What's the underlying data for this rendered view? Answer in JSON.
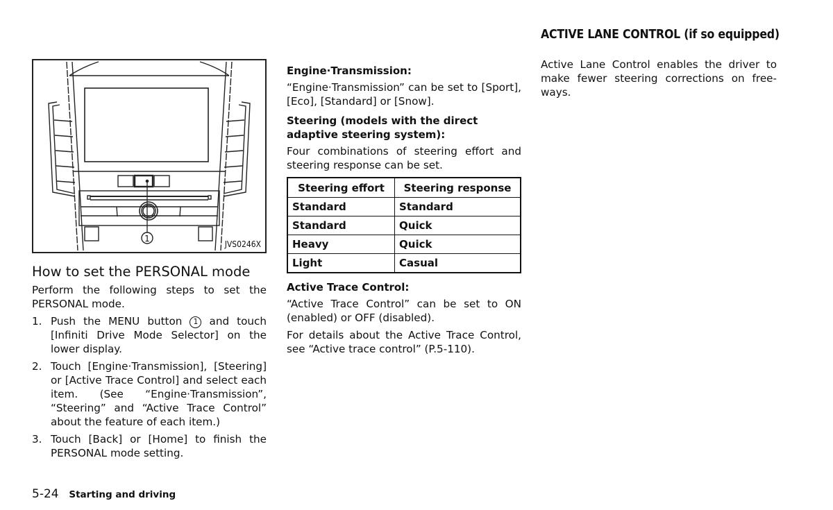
{
  "figure": {
    "code": "JVS0246X",
    "callout": "1",
    "callout_target": "menu-button"
  },
  "left_column": {
    "heading": "How to set the PERSONAL mode",
    "intro": "Perform the following steps to set the PERSONAL mode.",
    "steps": [
      {
        "num": "1.",
        "before": "Push the MENU button",
        "callout": "1",
        "after": "and touch [Infiniti Drive Mode Selector] on the lower display."
      },
      {
        "num": "2.",
        "text": "Touch [Engine·Transmission], [Steering] or [Active Trace Control] and select each item. (See “Engine·Transmission”, “Steering” and “Active Trace Control” about the feature of each item.)"
      },
      {
        "num": "3.",
        "text": "Touch [Back] or [Home] to finish the PERSONAL mode setting."
      }
    ]
  },
  "middle_column": {
    "engine_heading": "Engine·Transmission:",
    "engine_text": "“Engine·Transmission” can be set to [Sport], [Eco], [Standard] or [Snow].",
    "steering_heading": "Steering (models with the direct adaptive steering system):",
    "steering_text": "Four combinations of steering effort and steering response can be set.",
    "table": {
      "headers": [
        "Steering effort",
        "Steering response"
      ],
      "rows": [
        [
          "Standard",
          "Standard"
        ],
        [
          "Standard",
          "Quick"
        ],
        [
          "Heavy",
          "Quick"
        ],
        [
          "Light",
          "Casual"
        ]
      ]
    },
    "atc_heading": "Active Trace Control:",
    "atc_text": "“Active Trace Control” can be set to ON (enabled) or OFF (disabled).",
    "atc_details": "For details about the Active Trace Control, see “Active trace control” (P.5-110)."
  },
  "right_column": {
    "heading": "ACTIVE LANE CONTROL (if so equipped)",
    "text": "Active Lane Control enables the driver to make fewer steering corrections on free-ways."
  },
  "footer": {
    "page_number": "5-24",
    "section": "Starting and driving"
  }
}
